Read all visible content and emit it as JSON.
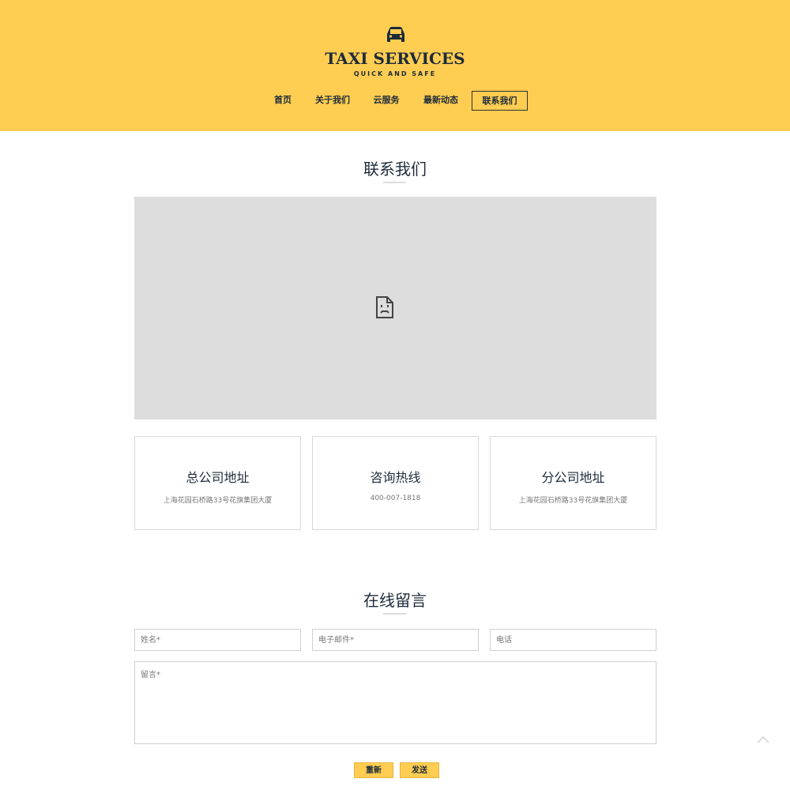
{
  "header": {
    "brand_title": "TAXI SERVICES",
    "brand_tagline": "QUICK AND SAFE",
    "logo_icon": "car-icon",
    "background_color": "#fecd51"
  },
  "nav": {
    "items": [
      {
        "label": "首页"
      },
      {
        "label": "关于我们"
      },
      {
        "label": "云服务"
      },
      {
        "label": "最新动态"
      },
      {
        "label": "联系我们",
        "active": true
      }
    ]
  },
  "contact": {
    "title": "联系我们",
    "map_placeholder_icon": "broken-image-icon",
    "cards": [
      {
        "title": "总公司地址",
        "text": "上海花园石桥路33号花旗集团大厦"
      },
      {
        "title": "咨询热线",
        "text": "400-007-1818"
      },
      {
        "title": "分公司地址",
        "text": "上海花园石桥路33号花旗集团大厦"
      }
    ]
  },
  "message": {
    "title": "在线留言",
    "name_placeholder": "姓名*",
    "email_placeholder": "电子邮件*",
    "phone_placeholder": "电话",
    "message_placeholder": "留言*",
    "reset_label": "重新",
    "send_label": "发送"
  },
  "scroll_top_icon": "chevron-up-icon",
  "colors": {
    "accent": "#fecd51",
    "text_dark": "#1d2b3a",
    "map_gray": "#dddddd"
  }
}
